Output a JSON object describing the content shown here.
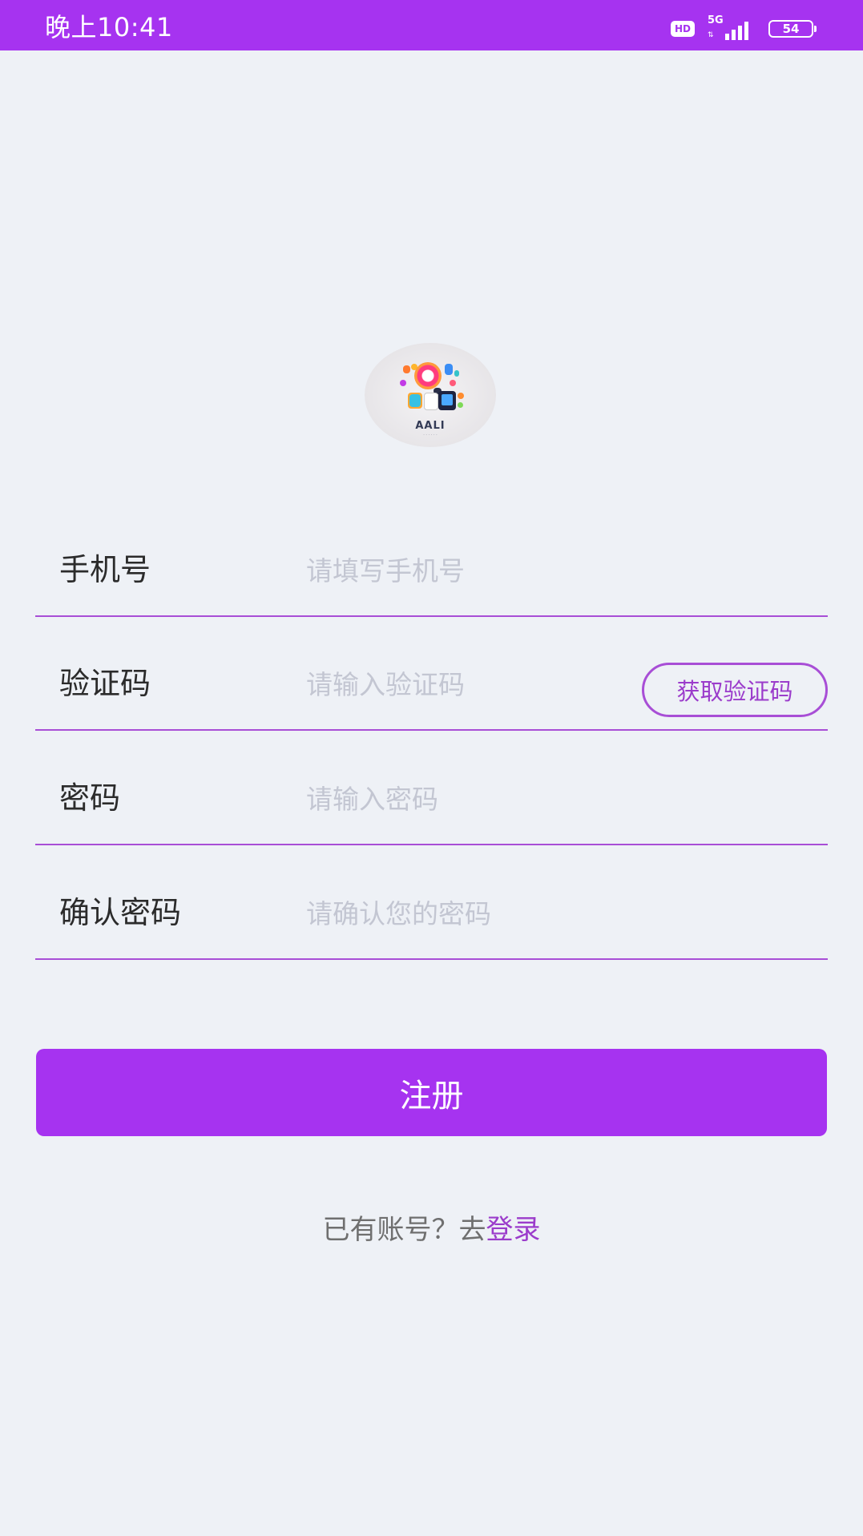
{
  "status_bar": {
    "time": "晚上10:41",
    "hd": "HD",
    "network": "5G",
    "battery": "54",
    "background_color": "#a633f0"
  },
  "logo": {
    "text": "AALI"
  },
  "form": {
    "phone": {
      "label": "手机号",
      "placeholder": "请填写手机号",
      "value": ""
    },
    "code": {
      "label": "验证码",
      "placeholder": "请输入验证码",
      "value": "",
      "button_label": "获取验证码"
    },
    "password": {
      "label": "密码",
      "placeholder": "请输入密码",
      "value": ""
    },
    "confirm_password": {
      "label": "确认密码",
      "placeholder": "请确认您的密码",
      "value": ""
    }
  },
  "register_button": {
    "label": "注册",
    "color": "#a633f0"
  },
  "footer": {
    "prompt": "已有账号？去",
    "login_link": "登录",
    "link_color": "#9b3ccb"
  },
  "colors": {
    "background": "#eef1f6",
    "divider": "#a84ed6"
  }
}
